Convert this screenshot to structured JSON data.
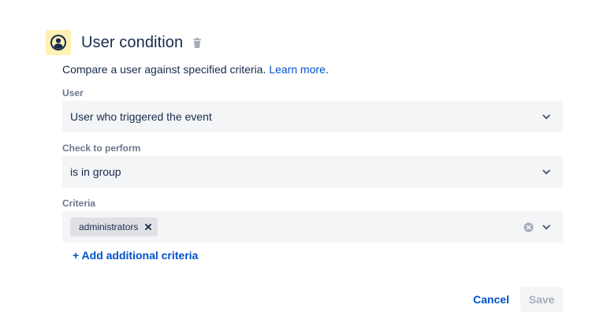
{
  "header": {
    "title": "User condition",
    "icon": "user-avatar-icon",
    "icon_bg": "#fff0b3",
    "delete_icon": "trash-icon"
  },
  "description": {
    "text": "Compare a user against specified criteria. ",
    "link": "Learn more",
    "suffix": "."
  },
  "fields": {
    "user": {
      "label": "User",
      "value": "User who triggered the event"
    },
    "check": {
      "label": "Check to perform",
      "value": "is in group"
    },
    "criteria": {
      "label": "Criteria",
      "tags": [
        "administrators"
      ]
    }
  },
  "add_criteria": "+ Add additional criteria",
  "footer": {
    "cancel_label": "Cancel",
    "save_label": "Save"
  },
  "colors": {
    "link": "#0052cc",
    "field_bg": "#f4f5f7",
    "tag_bg": "#dfe1e6",
    "text": "#172b4d",
    "label": "#6b778c",
    "disabled": "#a5adba"
  }
}
